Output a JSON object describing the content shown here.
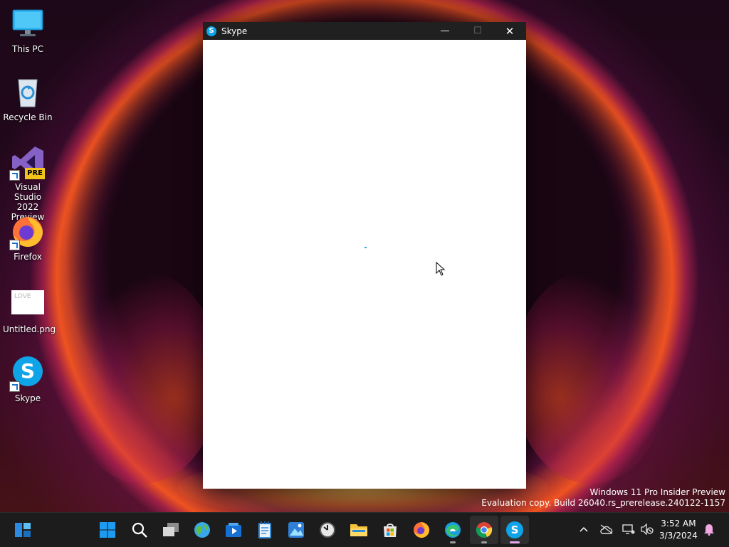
{
  "desktop": {
    "icons": [
      {
        "label": "This PC"
      },
      {
        "label": "Recycle Bin"
      },
      {
        "label": "Visual Studio 2022 Preview",
        "badge": "PRE"
      },
      {
        "label": "Firefox"
      },
      {
        "label": "Untitled.png",
        "thumb_text": "LOVE"
      },
      {
        "label": "Skype"
      }
    ]
  },
  "window": {
    "title": "Skype",
    "app_icon_letter": "S",
    "controls": {
      "minimize": "—",
      "maximize": "☐",
      "close": "✕"
    }
  },
  "watermark": {
    "line1": "Windows 11 Pro Insider Preview",
    "line2": "Evaluation copy. Build 26040.rs_prerelease.240122-1157"
  },
  "taskbar": {
    "apps": [
      "start-icon",
      "search-icon",
      "task-view-icon",
      "widgets-icon",
      "media-player-icon",
      "notepad-icon",
      "photos-icon",
      "clock-icon",
      "file-explorer-icon",
      "store-icon",
      "firefox-icon",
      "edge-icon",
      "chrome-icon",
      "skype-icon"
    ],
    "skype_letter": "S",
    "tray": {
      "time": "3:52 AM",
      "date": "3/3/2024"
    }
  },
  "colors": {
    "skype_blue": "#0fa3e8",
    "taskbar_bg": "#1c1c1c",
    "titlebar_bg": "#202020"
  }
}
